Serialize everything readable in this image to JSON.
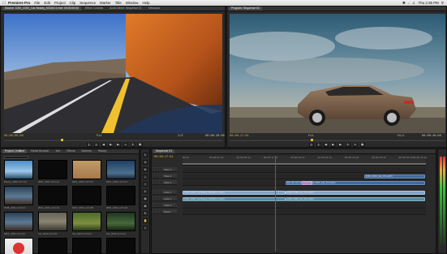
{
  "menubar": {
    "app_name": "Premiere Pro",
    "items": [
      "File",
      "Edit",
      "Project",
      "Clip",
      "Sequence",
      "Marker",
      "Title",
      "Window",
      "Help"
    ],
    "clock": "Thu 2:35 PM"
  },
  "source_monitor": {
    "tabs": [
      "Source: 1000_C000_Car Beauty_MC#02.0.mxf: 00:00:00:00",
      "Effect Controls",
      "Audio Mixer: Sequence 01",
      "Metadata"
    ],
    "timecode_in": "00:00:00:00",
    "timecode_out": "00:00:20:00",
    "fit": "Fit",
    "zoom": "1/2"
  },
  "program_monitor": {
    "tabs": [
      "Program: Sequence 01"
    ],
    "timecode_in": "00:00:17:01",
    "timecode_out": "00:00:40:08",
    "fit": "Fit",
    "zoom": "Full"
  },
  "project_panel": {
    "tabs": [
      "Project: Untitled",
      "Media Browser",
      "Info",
      "Effects",
      "Markers",
      "History"
    ],
    "search_placeholder": "",
    "items": [
      {
        "label": "Beauty_0003.mxf 7:12",
        "scene": "sky"
      },
      {
        "label": "0081_C001.mxf 1:12",
        "scene": "dark"
      },
      {
        "label": "0010_C001.mxf 5:14",
        "scene": "tan"
      },
      {
        "label": "0010_C003.mxf 3:13",
        "scene": "blue"
      },
      {
        "label": "0038_C001.mxf 4:13",
        "scene": "bridge"
      },
      {
        "label": "0042_C001.mxf 1:10",
        "scene": "dark"
      },
      {
        "label": "0047_C001.mxf 2:08",
        "scene": "dark"
      },
      {
        "label": "0063_C001.mxf 0:22",
        "scene": "dark"
      },
      {
        "label": "0081_C004.mxf 4:12",
        "scene": "bridge"
      },
      {
        "label": "Car_0019.mxf 9:11",
        "scene": "road"
      },
      {
        "label": "Car_0022.mxf 6:01",
        "scene": "green"
      },
      {
        "label": "Car_0039.mxf 4:12",
        "scene": "forest"
      },
      {
        "label": "Logo_03.psd 0:05",
        "scene": "logo"
      },
      {
        "label": "0112_C001.mxf 2:10",
        "scene": "dark"
      },
      {
        "label": "0115_C001.mxf 3:02",
        "scene": "dark"
      },
      {
        "label": "0118_C001.mxf 1:17",
        "scene": "dark"
      }
    ]
  },
  "timeline": {
    "tabs": [
      "Sequence 01"
    ],
    "timecode": "00:00:17:01",
    "ruler_labels": [
      "00:00",
      "00:00:04:23",
      "00:00:09:23",
      "00:00:14:23",
      "00:00:19:23",
      "00:00:24:23",
      "00:00:29:23",
      "00:00:34:23",
      "00:00:39:23",
      "00:00:44:22"
    ],
    "tracks": [
      "Video 3",
      "Video 2",
      "Video 1",
      "Audio 1",
      "Audio 2",
      "Audio 3",
      "Master"
    ],
    "clips": [
      {
        "track": 1,
        "label": "1000_C000_Car_Z3.mxf[V]",
        "start": 33.5,
        "end": 44.7,
        "kind": "video"
      },
      {
        "track": 2,
        "label": "RA_06_Car_MK_B92_0A.mov[V]",
        "start": 19.0,
        "end": 23.0,
        "kind": "video"
      },
      {
        "track": 2,
        "label": "1000_C000_Car_Z3.mxf[V]",
        "start": 23.0,
        "end": 44.7,
        "kind": "video"
      },
      {
        "track": 2,
        "label": "Cross Dissolve",
        "start": 22.0,
        "end": 24.0,
        "kind": "video"
      },
      {
        "track": 3,
        "label": "1000_C000_Car Beauty_MC#02.0.mxf[V]",
        "start": 0.0,
        "end": 19.0,
        "kind": "highlight"
      },
      {
        "track": 3,
        "label": "1000_C000_Car_Z3.mxf[V]",
        "start": 19.0,
        "end": 44.7,
        "kind": "highlight"
      },
      {
        "track": 4,
        "label": "1000_C000_Car Beauty_MC#02.0.mxf[A]",
        "start": 0.0,
        "end": 19.0,
        "kind": "audio"
      },
      {
        "track": 4,
        "label": "1000_C000_Car_Z3.mxf[A]",
        "start": 19.0,
        "end": 44.7,
        "kind": "audio"
      }
    ],
    "playhead_seconds": 17.04,
    "duration_seconds": 44.92
  },
  "tools": [
    "selection",
    "track-select",
    "ripple",
    "rolling",
    "rate-stretch",
    "razor",
    "slip",
    "slide",
    "pen",
    "hand",
    "zoom"
  ]
}
